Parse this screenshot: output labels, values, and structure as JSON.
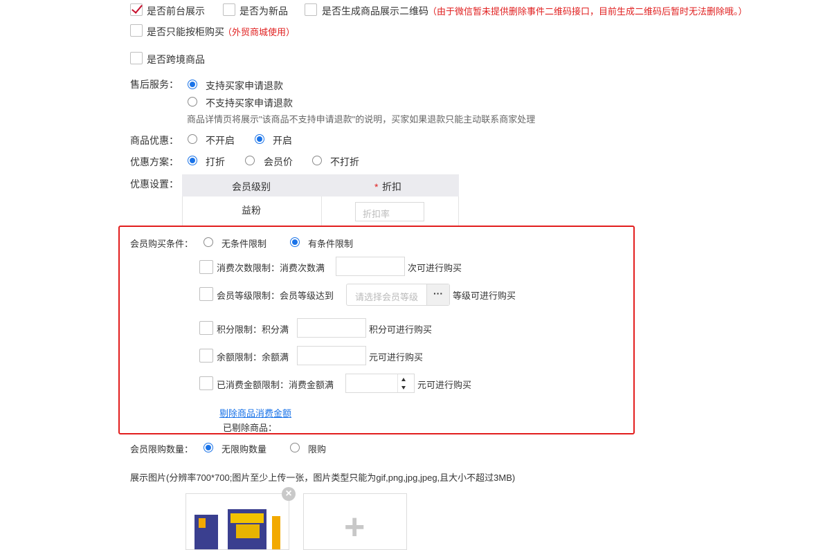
{
  "flags": {
    "front_display": "是否前台展示",
    "is_new": "是否为新品",
    "gen_qrcode": "是否生成商品展示二维码",
    "qrcode_note": "（由于微信暂未提供删除事件二维码接口，目前生成二维码后暂时无法删除哦。）",
    "counter_only": "是否只能按柜购买",
    "counter_note": "（外贸商城使用）",
    "cross_border": "是否跨境商品"
  },
  "after_sales": {
    "label": "售后服务：",
    "opt_support": "支持买家申请退款",
    "opt_not_support": "不支持买家申请退款",
    "note": "商品详情页将展示\"该商品不支持申请退款\"的说明，买家如果退款只能主动联系商家处理"
  },
  "discount": {
    "label": "商品优惠：",
    "off": "不开启",
    "on": "开启"
  },
  "scheme": {
    "label": "优惠方案：",
    "discount": "打折",
    "member_price": "会员价",
    "no_discount": "不打折"
  },
  "settings": {
    "label": "优惠设置：",
    "col_level": "会员级别",
    "col_discount_star": "*",
    "col_discount": "折扣",
    "row_level": "益粉",
    "rate_placeholder": "折扣率"
  },
  "purchase_condition": {
    "label": "会员购买条件：",
    "unconditional": "无条件限制",
    "conditional": "有条件限制",
    "count_label": "消费次数限制：消费次数满",
    "count_suffix": "次可进行购买",
    "level_label": "会员等级限制：会员等级达到",
    "level_placeholder": "请选择会员等级",
    "level_btn": "···",
    "level_suffix": "等级可进行购买",
    "points_label": "积分限制：积分满",
    "points_suffix": "积分可进行购买",
    "balance_label": "余额限制：余额满",
    "balance_suffix": "元可进行购买",
    "spent_label": "已消费金额限制：消费金额满",
    "spent_suffix": "元可进行购买",
    "exclude_link": "剔除商品消费金额",
    "excluded_label": "已剔除商品："
  },
  "limit_qty": {
    "label": "会员限购数量：",
    "unlimited": "无限购数量",
    "limited": "限购"
  },
  "images": {
    "label": "展示图片(分辨率700*700;图片至少上传一张，图片类型只能为gif,png,jpg,jpeg,且大小不超过3MB)",
    "add_glyph": "+",
    "remove_glyph": "×"
  },
  "colors": {
    "accent": "#1a73e8",
    "warning": "#e02020",
    "highlight_border": "#e21d1d"
  }
}
